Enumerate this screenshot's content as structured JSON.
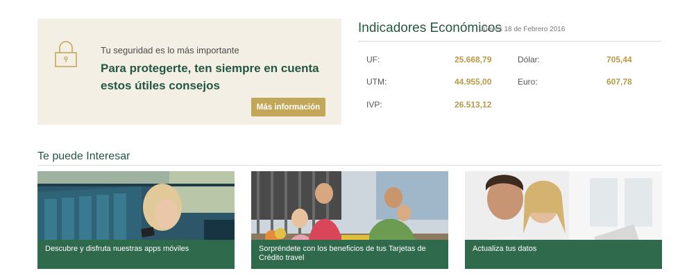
{
  "security": {
    "icon": "lock-icon",
    "subtitle": "Tu seguridad es lo más importante",
    "headline": "Para protegerte, ten siempre en cuenta estos útiles consejos",
    "button_label": "Más información"
  },
  "indicators": {
    "title": "Indicadores Económicos",
    "date": "Jueves 18 de Febrero 2016",
    "items": [
      {
        "label": "UF:",
        "value": "25.668,79"
      },
      {
        "label": "Dólar:",
        "value": "705,44"
      },
      {
        "label": "UTM:",
        "value": "44.955,00"
      },
      {
        "label": "Euro:",
        "value": "607,78"
      },
      {
        "label": "IVP:",
        "value": "26.513,12"
      }
    ]
  },
  "interest": {
    "heading": "Te puede Interesar",
    "cards": [
      {
        "caption": "Descubre y disfruta nuestras apps móviles"
      },
      {
        "caption": "Sorpréndete con los beneficios de tus Tarjetas de Crédito travel"
      },
      {
        "caption": "Actualiza tus datos"
      }
    ]
  },
  "colors": {
    "brand_green": "#23573f",
    "caption_green": "#2f6a4d",
    "gold": "#c2a75a",
    "panel_bg": "#f4efe4"
  }
}
